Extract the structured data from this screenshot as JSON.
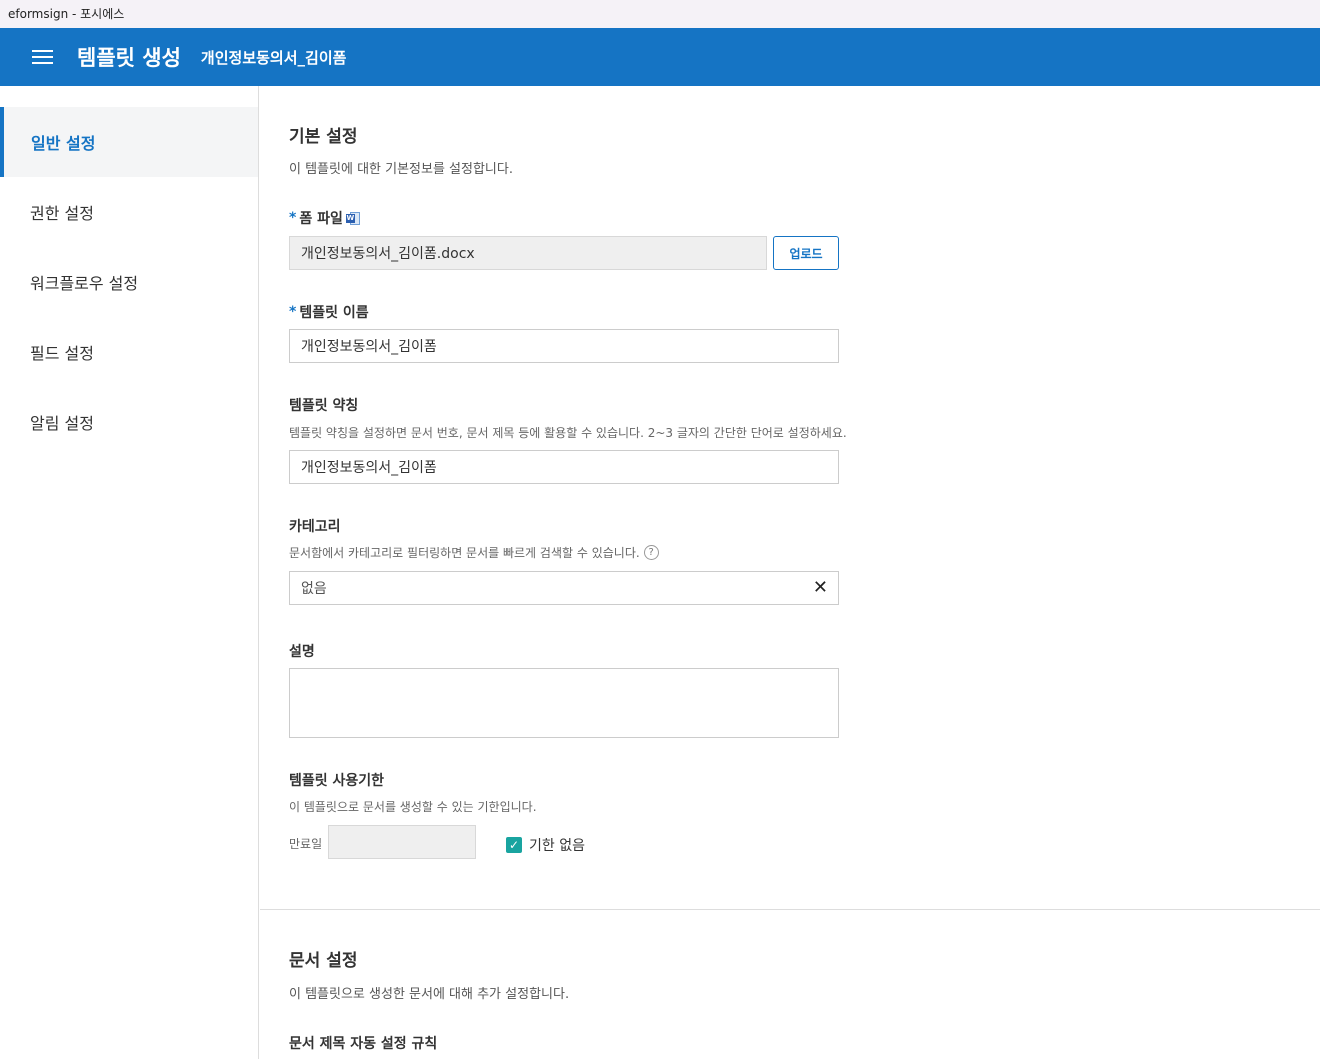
{
  "window": {
    "title": "eformsign - 포시에스"
  },
  "appbar": {
    "title": "템플릿 생성",
    "subtitle": "개인정보동의서_김이폼",
    "menu_icon": "hamburger-menu-icon"
  },
  "sidebar": {
    "items": [
      {
        "label": "일반 설정",
        "active": true
      },
      {
        "label": "권한 설정",
        "active": false
      },
      {
        "label": "워크플로우 설정",
        "active": false
      },
      {
        "label": "필드 설정",
        "active": false
      },
      {
        "label": "알림 설정",
        "active": false
      }
    ]
  },
  "basic": {
    "title": "기본 설정",
    "desc": "이 템플릿에 대한 기본정보를 설정합니다.",
    "form_file": {
      "label": "폼 파일",
      "required_mark": "*",
      "value": "개인정보동의서_김이폼.docx",
      "upload_label": "업로드"
    },
    "template_name": {
      "label": "템플릿 이름",
      "required_mark": "*",
      "value": "개인정보동의서_김이폼"
    },
    "abbreviation": {
      "label": "템플릿 약칭",
      "hint": "템플릿 약칭을 설정하면 문서 번호, 문서 제목 등에 활용할 수 있습니다. 2~3 글자의 간단한 단어로 설정하세요.",
      "value": "개인정보동의서_김이폼"
    },
    "category": {
      "label": "카테고리",
      "hint": "문서함에서 카테고리로 필터링하면 문서를 빠르게 검색할 수 있습니다.",
      "help_glyph": "?",
      "value": "없음",
      "clear_glyph": "✕"
    },
    "description": {
      "label": "설명",
      "value": ""
    },
    "expiry": {
      "label": "템플릿 사용기한",
      "hint": "이 템플릿으로 문서를 생성할 수 있는 기한입니다.",
      "date_label": "만료일",
      "date_value": "",
      "no_limit_label": "기한 없음",
      "no_limit_checked": true,
      "check_glyph": "✓"
    }
  },
  "document": {
    "title": "문서 설정",
    "desc": "이 템플릿으로 생성한 문서에 대해 추가 설정합니다.",
    "auto_title_label": "문서 제목 자동 설정 규칙"
  },
  "colors": {
    "primary": "#1574c4",
    "checkbox": "#19a4a0"
  }
}
